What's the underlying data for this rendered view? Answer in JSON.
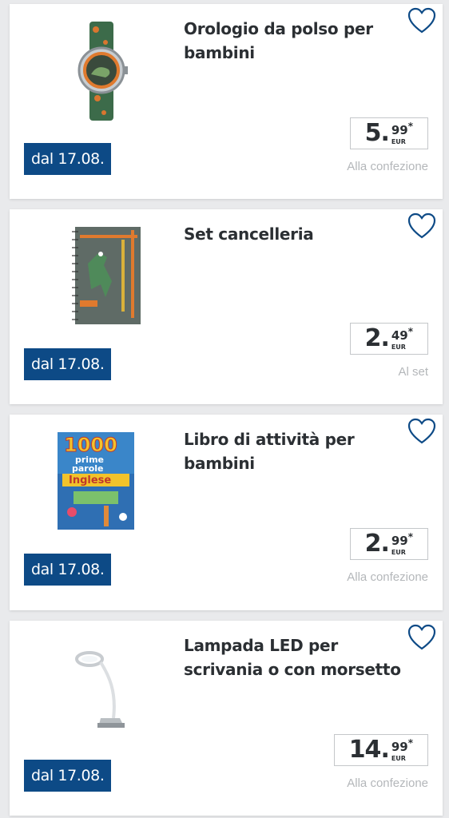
{
  "colors": {
    "badge_bg": "#0d4a86",
    "heart": "#0d4a86",
    "text": "#2b2f33",
    "unit": "#b4b7ba"
  },
  "products": [
    {
      "title": "Orologio da polso per bambini",
      "price_int": "5",
      "price_dec": "99",
      "price_mark": "*",
      "currency": "EUR",
      "unit": "Alla confezione",
      "badge": "dal 17.08.",
      "image_icon": "kids-watch-image",
      "favorite_icon": "heart-icon"
    },
    {
      "title": "Set cancelleria",
      "price_int": "2",
      "price_dec": "49",
      "price_mark": "*",
      "currency": "EUR",
      "unit": "Al set",
      "badge": "dal 17.08.",
      "image_icon": "stationery-set-image",
      "favorite_icon": "heart-icon"
    },
    {
      "title": "Libro di attività per bambini",
      "price_int": "2",
      "price_dec": "99",
      "price_mark": "*",
      "currency": "EUR",
      "unit": "Alla confezione",
      "badge": "dal 17.08.",
      "image_icon": "activity-book-image",
      "book_cover": {
        "line1": "1000",
        "line2": "prime",
        "line3": "parole",
        "line4": "Inglese"
      },
      "favorite_icon": "heart-icon"
    },
    {
      "title": "Lampada LED per scrivania o con morsetto",
      "price_int": "14",
      "price_dec": "99",
      "price_mark": "*",
      "currency": "EUR",
      "unit": "Alla confezione",
      "badge": "dal 17.08.",
      "image_icon": "led-lamp-image",
      "favorite_icon": "heart-icon"
    }
  ]
}
